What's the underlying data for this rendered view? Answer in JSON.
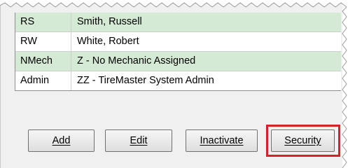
{
  "users_table": {
    "rows": [
      {
        "code": "RS",
        "name": "Smith, Russell"
      },
      {
        "code": "RW",
        "name": "White, Robert"
      },
      {
        "code": "NMech",
        "name": "Z - No Mechanic Assigned"
      },
      {
        "code": "Admin",
        "name": "ZZ - TireMaster System Admin"
      }
    ]
  },
  "buttons": {
    "add": "Add",
    "edit": "Edit",
    "inactivate": "Inactivate",
    "security": "Security"
  },
  "colors": {
    "alt_row": "#d4ead4",
    "highlight": "#d2232a"
  }
}
